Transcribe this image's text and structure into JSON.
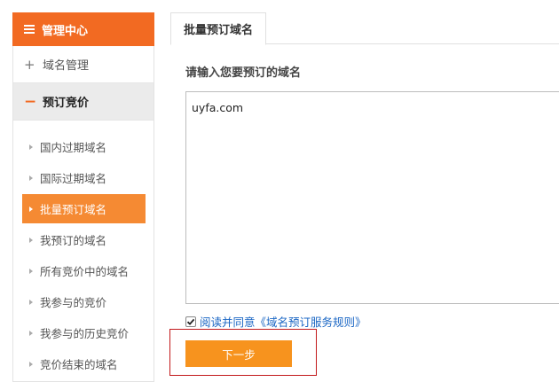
{
  "sidebar": {
    "header": "管理中心",
    "groups": [
      {
        "symbol": "+",
        "label": "域名管理"
      },
      {
        "symbol": "−",
        "label": "预订竞价"
      }
    ],
    "items": [
      {
        "label": "国内过期域名"
      },
      {
        "label": "国际过期域名"
      },
      {
        "label": "批量预订域名"
      },
      {
        "label": "我预订的域名"
      },
      {
        "label": "所有竞价中的域名"
      },
      {
        "label": "我参与的竞价"
      },
      {
        "label": "我参与的历史竞价"
      },
      {
        "label": "竞价结束的域名"
      }
    ]
  },
  "main": {
    "tab_label": "批量预订域名",
    "prompt": "请输入您要预订的域名",
    "domains_value": "uyfa.com",
    "agree_checked": true,
    "agree_text": "阅读并同意《域名预订服务规则》",
    "next_button": "下一步"
  },
  "colors": {
    "accent": "#f26a22",
    "active_item": "#f58a33",
    "button": "#f7931e",
    "link": "#1a66c4",
    "highlight_border": "#c2191b"
  }
}
